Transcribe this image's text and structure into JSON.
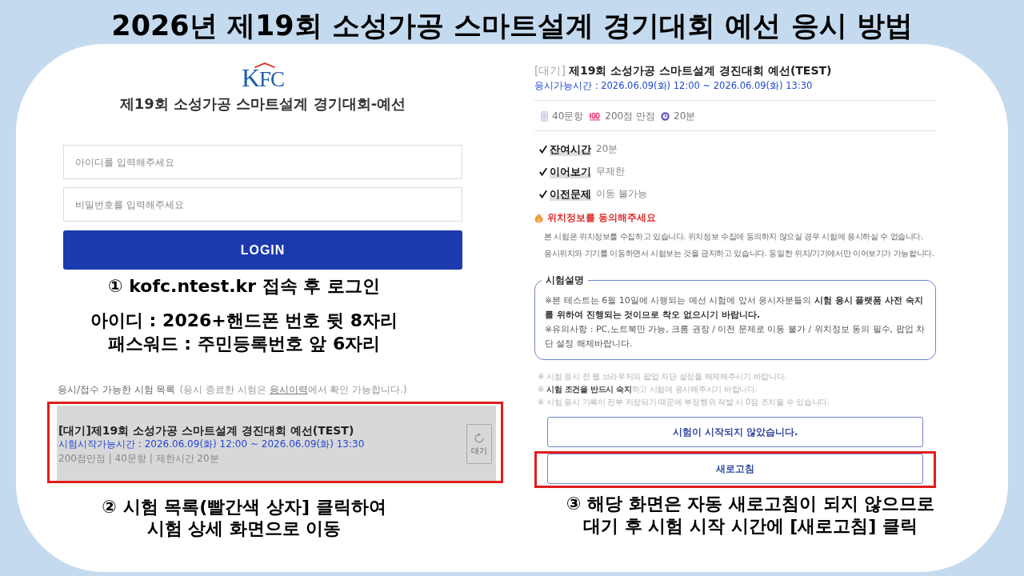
{
  "title": "2026년 제19회 소성가공 스마트설계 경기대회 예선 응시 방법",
  "login_panel": {
    "logo_text": "KFC",
    "heading": "제19회 소성가공 스마트설계 경기대회-예선",
    "fields": [
      {
        "placeholder": "아이디를 입력해주세요"
      },
      {
        "placeholder": "비밀번호를 입력해주세요"
      }
    ],
    "login_button": "LOGIN"
  },
  "step_1": {
    "caption": "① kofc.ntest.kr 접속 후 로그인",
    "lines": [
      "아이디 : 2026+핸드폰 번호 뒷 8자리",
      "패스워드 : 주민등록번호 앞 6자리"
    ]
  },
  "exam_list": {
    "heading": "응시/접수 가능한 시험 목록",
    "note": {
      "before": "(응시 종료한 시험은 ",
      "link": "응시이력",
      "after": "에서 확인 가능합니다.)"
    },
    "items": [
      {
        "title": "[대기]제19회 소성가공 스마트설계 경진대회 예선(TEST)",
        "time": "시험시작가능시간 : 2026.06.09(화) 12:00 ~ 2026.06.09(화) 13:30",
        "meta": "200점만점 | 40문항 | 제한시간 20분",
        "badge": "대기",
        "highlighted": true
      }
    ]
  },
  "step_2": {
    "lines": [
      "② 시험 목록(빨간색 상자] 클릭하여",
      "시험 상세 화면으로 이동"
    ]
  },
  "exam_detail": {
    "status": "[대기]",
    "title": "제19회 소성가공 스마트설계 경진대회 예선(TEST)",
    "time": "응시가능시간 : 2026.06.09(화) 12:00 ~ 2026.06.09(화) 13:30",
    "stats": [
      {
        "kind": "questions",
        "text": "40문항"
      },
      {
        "kind": "score",
        "text": "200점 만점"
      },
      {
        "kind": "time",
        "text": "20분"
      }
    ],
    "conditions": [
      {
        "label": "잔여시간",
        "value": "20분"
      },
      {
        "label": "이어보기",
        "value": "무제한"
      },
      {
        "label": "이전문제",
        "value": "이동 불가능"
      }
    ],
    "notice": {
      "title": "위치정보를 동의해주세요",
      "lines": [
        "본 시험은 위치정보를 수집하고 있습니다. 위치정보 수집에 동의하지 않으실 경우 시험에 응시하실 수 없습니다.",
        "응시위치와 기기를 이동하면서 시험보는 것을 금지하고 있습니다. 동일한 위치/기기에서만 이어보기가 가능합니다."
      ]
    },
    "description": {
      "legend": "시험설명",
      "paragraphs": [
        "※본 테스트는 6월 10일에 시행되는 예선 시험에 앞서 응시자분들의 **시험 응시 플랫폼 사전 숙지를 위하여 진행되는 것이므로 착오 없으시기 바랍니다.**",
        "※유의사항 : PC,노트북만 가능, 크롬 권장 / 이전 문제로 이동 불가 / 위치정보 동의 필수, 팝업 차단 설정 해제바랍니다."
      ]
    },
    "notes": [
      "※ 시험 응시 전 웹 브라우저의 팝업 차단 설정을 해제해주시기 바랍니다.",
      "※ **시험 조건을 반드시 숙지**하고 시험에 응시해주시기 바랍니다.",
      "※ 시험 응시 기록이 전부 저장되기 때문에 부정행위 적발 시 0점 조치될 수 있습니다."
    ],
    "buttons": [
      {
        "label": "시험이 시작되지 않았습니다.",
        "highlighted": false
      },
      {
        "label": "새로고침",
        "highlighted": true
      }
    ]
  },
  "step_3": {
    "lines": [
      "③ 해당 화면은 자동 새로고침이 되지 않으므로",
      "대기 후 시험 시작 시간에 [새로고침] 클릭"
    ]
  }
}
